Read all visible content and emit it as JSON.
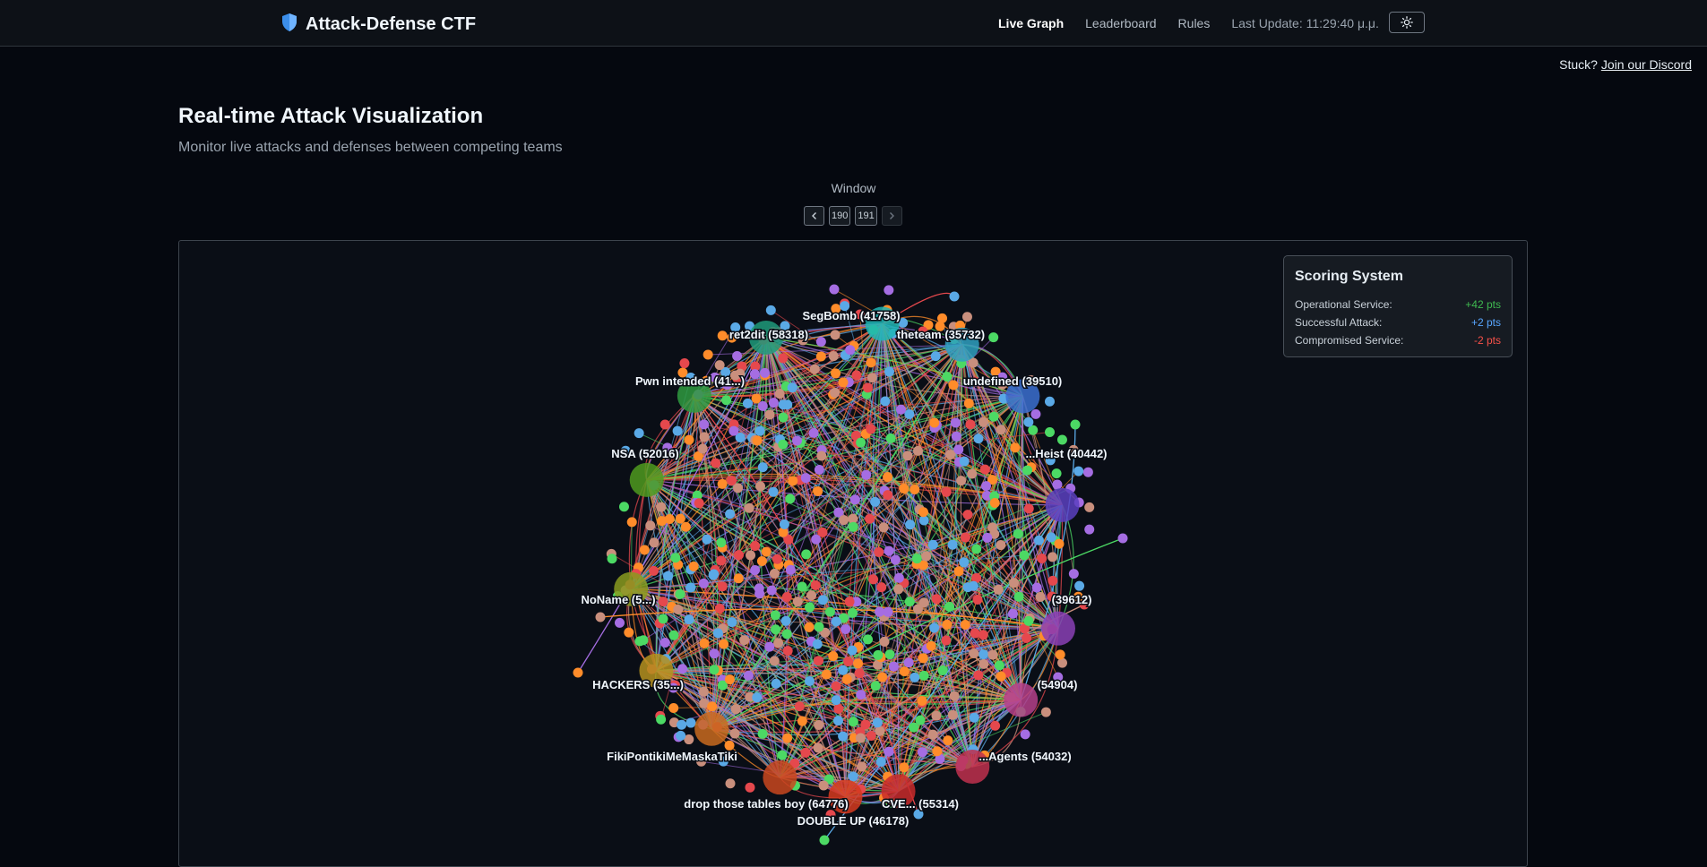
{
  "header": {
    "title": "Attack-Defense CTF",
    "nav": [
      "Live Graph",
      "Leaderboard",
      "Rules"
    ],
    "last_update": "Last Update: 11:29:40 μ.μ."
  },
  "help": {
    "prefix": "Stuck?",
    "link": "Join our Discord"
  },
  "page": {
    "title": "Real-time Attack Visualization",
    "subtitle": "Monitor live attacks and defenses between competing teams"
  },
  "window": {
    "label": "Window",
    "pages": [
      "190",
      "191"
    ]
  },
  "scoring": {
    "title": "Scoring System",
    "rows": [
      {
        "label": "Operational Service:",
        "value": "+42 pts"
      },
      {
        "label": "Successful Attack:",
        "value": "+2 pts"
      },
      {
        "label": "Compromised Service:",
        "value": "-2 pts"
      }
    ]
  },
  "graph": {
    "teams": [
      {
        "label": "SegBomb (41758)",
        "color": "#1fb5b5"
      },
      {
        "label": "theteam (35732)",
        "color": "#2f9fbf"
      },
      {
        "label": "undefined (39510)",
        "color": "#3b6fd0"
      },
      {
        "label": "...Heist (40442)",
        "color": "#5a3fc0"
      },
      {
        "label": "(39612)",
        "color": "#8a3fb5"
      },
      {
        "label": "(54904)",
        "color": "#b53f8a"
      },
      {
        "label": "...Agents (54032)",
        "color": "#c0304e"
      },
      {
        "label": "CVE... (55314)",
        "color": "#c92a2a"
      },
      {
        "label": "DOUBLE UP (46178)",
        "color": "#d63a1f"
      },
      {
        "label": "drop those tables boy (64776)",
        "color": "#c9471f"
      },
      {
        "label": "FikiPontikiMeMaskaTiki",
        "color": "#c96a1f"
      },
      {
        "label": "HACKERS (35...)",
        "color": "#b5901f"
      },
      {
        "label": "NoName (5...)",
        "color": "#8a9a1f"
      },
      {
        "label": "NSA (52016)",
        "color": "#4f9a1f"
      },
      {
        "label": "Pwn intended (41...)",
        "color": "#2f9a3f"
      },
      {
        "label": "ret2dit (58318)",
        "color": "#1f9a7a"
      }
    ],
    "edge_colors": [
      "#e5484d",
      "#5aa9e6",
      "#4cd964",
      "#a56de2",
      "#ff8c2a",
      "#c98f7d"
    ]
  }
}
